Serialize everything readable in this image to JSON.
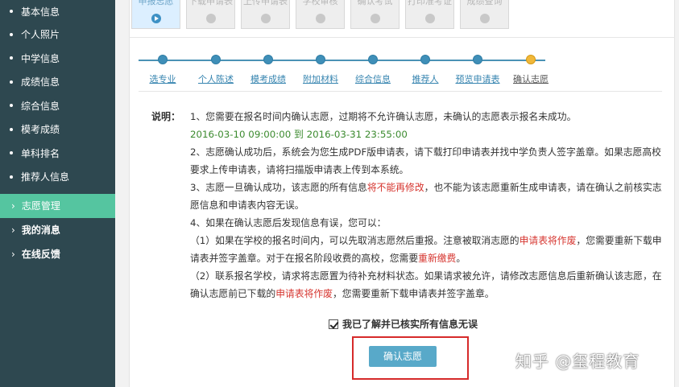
{
  "sidebar": {
    "sub_items": [
      {
        "label": "基本信息"
      },
      {
        "label": "个人照片"
      },
      {
        "label": "中学信息"
      },
      {
        "label": "成绩信息"
      },
      {
        "label": "综合信息"
      },
      {
        "label": "模考成绩"
      },
      {
        "label": "单科排名"
      },
      {
        "label": "推荐人信息"
      }
    ],
    "main_items": [
      {
        "label": "志愿管理",
        "chevron": "›",
        "active": true
      },
      {
        "label": "我的消息",
        "chevron": "›"
      },
      {
        "label": "在线反馈",
        "chevron": "›"
      }
    ],
    "colors": {
      "background": "#2e4850",
      "active": "#55c5a0"
    }
  },
  "tabs": [
    {
      "label": "申报志愿",
      "active": true
    },
    {
      "label": "下载申请表"
    },
    {
      "label": "上传申请表"
    },
    {
      "label": "学校审核"
    },
    {
      "label": "确认考试"
    },
    {
      "label": "打印准考证"
    },
    {
      "label": "成绩查询"
    }
  ],
  "steps": [
    {
      "label": "选专业"
    },
    {
      "label": "个人陈述"
    },
    {
      "label": "模考成绩"
    },
    {
      "label": "附加材料"
    },
    {
      "label": "综合信息"
    },
    {
      "label": "推荐人"
    },
    {
      "label": "预览申请表"
    },
    {
      "label": "确认志愿",
      "current": true
    }
  ],
  "instructions": {
    "label": "说明：",
    "p1": "1、您需要在报名时间内确认志愿，过期将不允许确认志愿，未确认的志愿表示报名未成功。",
    "time_range": "2016-03-10 09:00:00 到 2016-03-31 23:55:00",
    "p2": "2、志愿确认成功后，系统会为您生成PDF版申请表，请下载打印申请表并找中学负责人签字盖章。如果志愿高校要求上传申请表，请将扫描版申请表上传到本系统。",
    "p3_a": "3、志愿一旦确认成功，该志愿的所有信息",
    "p3_red": "将不能再修改",
    "p3_b": "，也不能为该志愿重新生成申请表，请在确认之前核实志愿信息和申请表内容无误。",
    "p4": "4、如果在确认志愿后发现信息有误，您可以：",
    "p5_a": "（1）如果在学校的报名时间内，可以先取消志愿然后重报。注意被取消志愿的",
    "p5_red1": "申请表将作废",
    "p5_b": "，您需要重新下载申请表并签字盖章。对于在报名阶段收费的高校，您需要",
    "p5_red2": "重新缴费",
    "p5_c": "。",
    "p6_a": "（2）联系报名学校，请求将志愿置为待补充材料状态。如果请求被允许，请修改志愿信息后重新确认该志愿，在确认志愿前已下载的",
    "p6_red": "申请表将作废",
    "p6_b": "，您需要重新下载申请表并签字盖章。"
  },
  "agree": {
    "label": "我已了解并已核实所有信息无误",
    "checked": true
  },
  "confirm_button": {
    "label": "确认志愿",
    "color": "#58a9c9"
  },
  "watermark": "知乎 @玺程教育"
}
